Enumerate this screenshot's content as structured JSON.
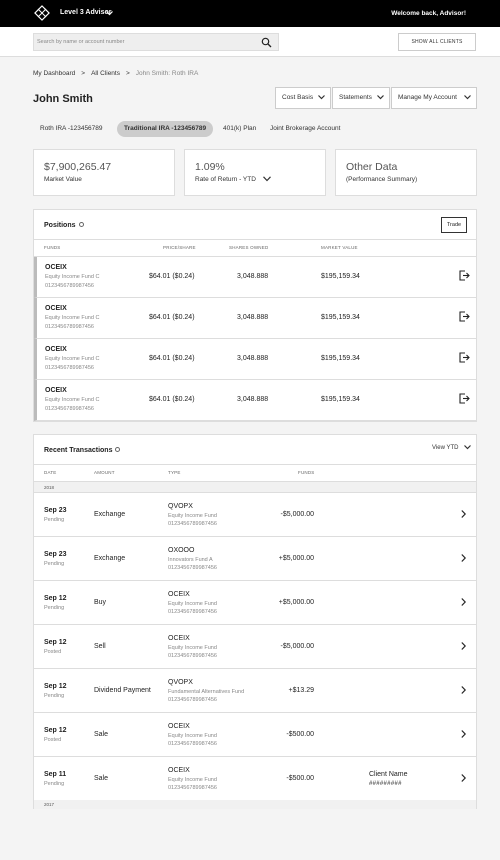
{
  "header": {
    "level_label": "Level 3 Advisor",
    "welcome": "Welcome back, Advisor!"
  },
  "search": {
    "placeholder": "Search by name or account number",
    "show_all": "SHOW ALL CLIENTS"
  },
  "breadcrumb": {
    "items": [
      "My Dashboard",
      "All Clients",
      "John Smith: Roth IRA"
    ],
    "separator": ">"
  },
  "client": {
    "name": "John Smith"
  },
  "actions": {
    "cost_basis": "Cost Basis",
    "statements": "Statements",
    "manage": "Manage My Account"
  },
  "account_tabs": [
    "Roth IRA -123456789",
    "Traditional IRA -123456789",
    "401(k) Plan",
    "Joint Brokerage Account"
  ],
  "summary": {
    "market_value": "$7,900,265.47",
    "market_value_label": "Market Value",
    "return": "1.09%",
    "return_label": "Rate of Return - YTD",
    "other": "Other Data",
    "other_label": "(Performance Summary)"
  },
  "positions": {
    "title": "Positions",
    "trade": "Trade",
    "headers": {
      "funds": "FUNDS",
      "price": "PRICE/SHARE",
      "shares": "SHARES OWNED",
      "value": "MARKET VALUE"
    },
    "rows": [
      {
        "ticker": "OCEIX",
        "fund": "Equity Income Fund C",
        "account": "0123456789987456",
        "price": "$64.01  ($0.24)",
        "shares": "3,048.888",
        "value": "$195,159.34"
      },
      {
        "ticker": "OCEIX",
        "fund": "Equity Income Fund C",
        "account": "0123456789987456",
        "price": "$64.01  ($0.24)",
        "shares": "3,048.888",
        "value": "$195,159.34"
      },
      {
        "ticker": "OCEIX",
        "fund": "Equity Income Fund C",
        "account": "0123456789987456",
        "price": "$64.01  ($0.24)",
        "shares": "3,048.888",
        "value": "$195,159.34"
      },
      {
        "ticker": "OCEIX",
        "fund": "Equity Income Fund C",
        "account": "0123456789987456",
        "price": "$64.01  ($0.24)",
        "shares": "3,048.888",
        "value": "$195,159.34"
      }
    ]
  },
  "transactions": {
    "title": "Recent Transactions",
    "view": "View YTD",
    "headers": {
      "date": "DATE",
      "amount": "AMOUNT",
      "type": "TYPE",
      "funds": "FUNDS"
    },
    "year1": "2018",
    "year2": "2017",
    "rows": [
      {
        "date": "Sep 23",
        "status": "Pending",
        "kind": "Exchange",
        "ticker": "QVOPX",
        "fund": "Equity Income Fund",
        "account": "0123456789987456",
        "value": "-$5,000.00",
        "client_name": "",
        "client_value": ""
      },
      {
        "date": "Sep 23",
        "status": "Pending",
        "kind": "Exchange",
        "ticker": "OXOOO",
        "fund": "Innovators Fund A",
        "account": "0123456789987456",
        "value": "+$5,000.00",
        "client_name": "",
        "client_value": ""
      },
      {
        "date": "Sep 12",
        "status": "Pending",
        "kind": "Buy",
        "ticker": "OCEIX",
        "fund": "Equity Income Fund",
        "account": "0123456789987456",
        "value": "+$5,000.00",
        "client_name": "",
        "client_value": ""
      },
      {
        "date": "Sep 12",
        "status": "Posted",
        "kind": "Sell",
        "ticker": "OCEIX",
        "fund": "Equity Income Fund",
        "account": "0123456789987456",
        "value": "-$5,000.00",
        "client_name": "",
        "client_value": ""
      },
      {
        "date": "Sep 12",
        "status": "Pending",
        "kind": "Dividend Payment",
        "ticker": "QVOPX",
        "fund": "Fundamental Alternatives Fund",
        "account": "0123456789987456",
        "value": "+$13.29",
        "client_name": "",
        "client_value": ""
      },
      {
        "date": "Sep 12",
        "status": "Posted",
        "kind": "Sale",
        "ticker": "OCEIX",
        "fund": "Equity Income Fund",
        "account": "0123456789987456",
        "value": "-$500.00",
        "client_name": "",
        "client_value": ""
      },
      {
        "date": "Sep 11",
        "status": "Pending",
        "kind": "Sale",
        "ticker": "OCEIX",
        "fund": "Equity Income Fund",
        "account": "0123456789987456",
        "value": "-$500.00",
        "client_name": "Client Name",
        "client_value": "#########"
      }
    ]
  }
}
